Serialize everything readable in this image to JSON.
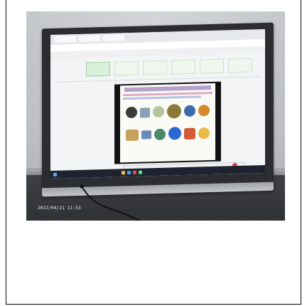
{
  "photo": {
    "subject": "wall-mounted-touchscreen-display",
    "timestamp": "2022/04/21 11:53"
  },
  "colors": {
    "wall": "#c9cccf",
    "floor": "#33363a",
    "bezel": "#2b2d30",
    "screen_bg": "#f3f4f6",
    "slide_accent": "#7a5aa8",
    "taskbar": "#1d2330"
  }
}
